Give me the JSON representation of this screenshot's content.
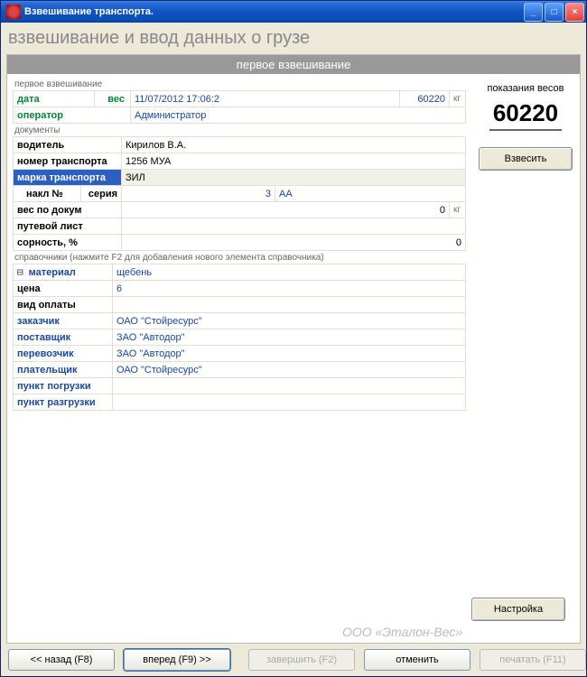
{
  "window": {
    "title": "Взвешивание транспорта."
  },
  "page": {
    "title": "взвешивание и ввод данных о грузе",
    "banner": "первое взвешивание"
  },
  "sidebar": {
    "scale_label": "показания весов",
    "scale_value": "60220",
    "weigh_button": "Взвесить",
    "settings_button": "Настройка"
  },
  "section1": {
    "header": "первое взвешивание",
    "date_label": "дата",
    "weight_label": "вес",
    "date_value": "11/07/2012 17:06:2",
    "weight_value": "60220",
    "weight_unit": "кг",
    "operator_label": "оператор",
    "operator_value": "Администратор"
  },
  "section2": {
    "header": "документы",
    "driver_label": "водитель",
    "driver_value": "Кирилов В.А.",
    "number_label": "номер транспорта",
    "number_value": "1256 МУА",
    "brand_label": "марка транспорта",
    "brand_value": "ЗИЛ",
    "nakl_label": "накл №",
    "series_label": "серия",
    "nakl_value": "3",
    "series_value": "AA",
    "docweight_label": "вес по докум",
    "docweight_value": "0",
    "docweight_unit": "кг",
    "route_label": "путевой лист",
    "route_value": "",
    "sornost_label": "сорность, %",
    "sornost_value": "0"
  },
  "section3": {
    "header": "справочники (нажмите F2 для добавления нового элемента справочника)",
    "material_label": "материал",
    "material_value": "щебень",
    "price_label": "цена",
    "price_value": "6",
    "paytype_label": "вид оплаты",
    "paytype_value": "",
    "customer_label": "заказчик",
    "customer_value": "ОАО \"Стойресурс\"",
    "supplier_label": "поставщик",
    "supplier_value": "ЗАО \"Автодор\"",
    "carrier_label": "перевозчик",
    "carrier_value": "ЗАО \"Автодор\"",
    "payer_label": "плательщик",
    "payer_value": "ОАО \"Стойресурс\"",
    "loadpoint_label": "пункт погрузки",
    "loadpoint_value": "",
    "unloadpoint_label": "пункт разгрузки",
    "unloadpoint_value": ""
  },
  "watermark": "ООО «Эталон-Вес»",
  "footer": {
    "back": "<< назад (F8)",
    "forward": "вперед (F9) >>",
    "finish": "завершить (F2)",
    "cancel": "отменить",
    "print": "печатать (F11)"
  }
}
